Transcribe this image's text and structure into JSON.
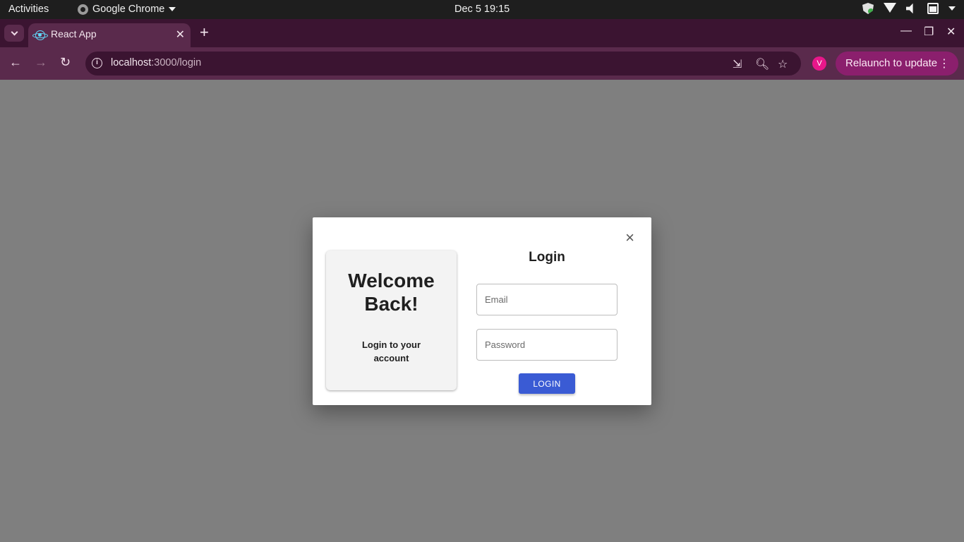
{
  "system_bar": {
    "activities": "Activities",
    "app_name": "Google Chrome",
    "clock": "Dec 5  19:15"
  },
  "browser": {
    "tab_title": "React App",
    "url_host": "localhost",
    "url_path": ":3000/login",
    "profile_initial": "V",
    "relaunch_label": "Relaunch to update",
    "accent": "#8b1f6d"
  },
  "modal": {
    "close": "×",
    "welcome_title": "Welcome Back!",
    "welcome_subtitle": "Login to your account",
    "form_title": "Login",
    "email_placeholder": "Email",
    "password_placeholder": "Password",
    "submit_label": "LOGIN",
    "button_color": "#3a5bd4"
  }
}
